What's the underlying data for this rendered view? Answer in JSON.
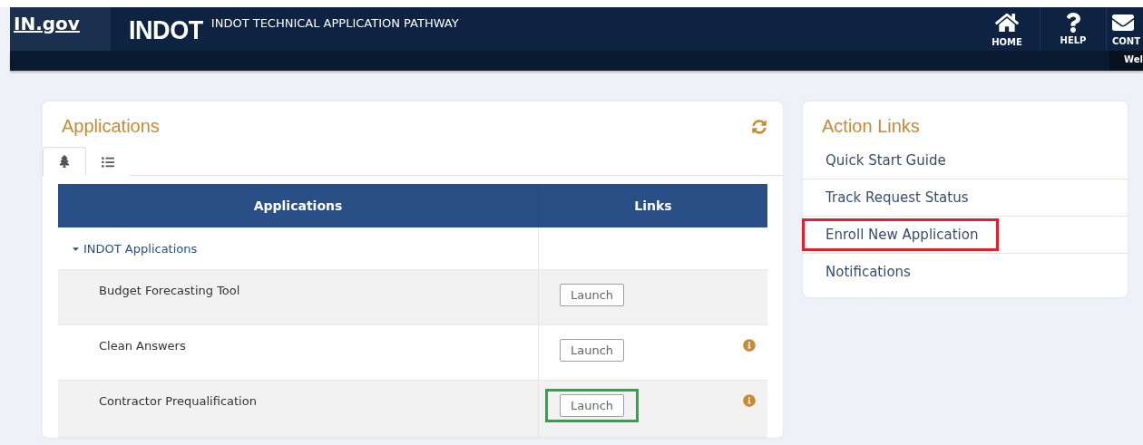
{
  "header": {
    "logo": "IN.gov",
    "brand": "INDOT",
    "title": "INDOT TECHNICAL APPLICATION PATHWAY",
    "nav": [
      {
        "kind": "home",
        "label": "HOME"
      },
      {
        "kind": "help",
        "label": "HELP"
      },
      {
        "kind": "contact",
        "label": "CONT"
      }
    ],
    "welcome": "Wel"
  },
  "applications": {
    "title": "Applications",
    "tabs": [
      {
        "kind": "tree",
        "selected": true
      },
      {
        "kind": "list",
        "selected": false
      }
    ],
    "columns": [
      "Applications",
      "Links"
    ],
    "group": {
      "label": "INDOT Applications",
      "expanded": true
    },
    "rows": [
      {
        "name": "Budget Forecasting Tool",
        "button": "Launch",
        "info": false,
        "highlighted": false
      },
      {
        "name": "Clean Answers",
        "button": "Launch",
        "info": true,
        "highlighted": false
      },
      {
        "name": "Contractor Prequalification",
        "button": "Launch",
        "info": true,
        "highlighted": true
      }
    ]
  },
  "action_links": {
    "title": "Action Links",
    "items": [
      {
        "label": "Quick Start Guide",
        "highlighted": false
      },
      {
        "label": "Track Request Status",
        "highlighted": false
      },
      {
        "label": "Enroll New Application",
        "highlighted": true
      },
      {
        "label": "Notifications",
        "highlighted": false
      }
    ]
  }
}
